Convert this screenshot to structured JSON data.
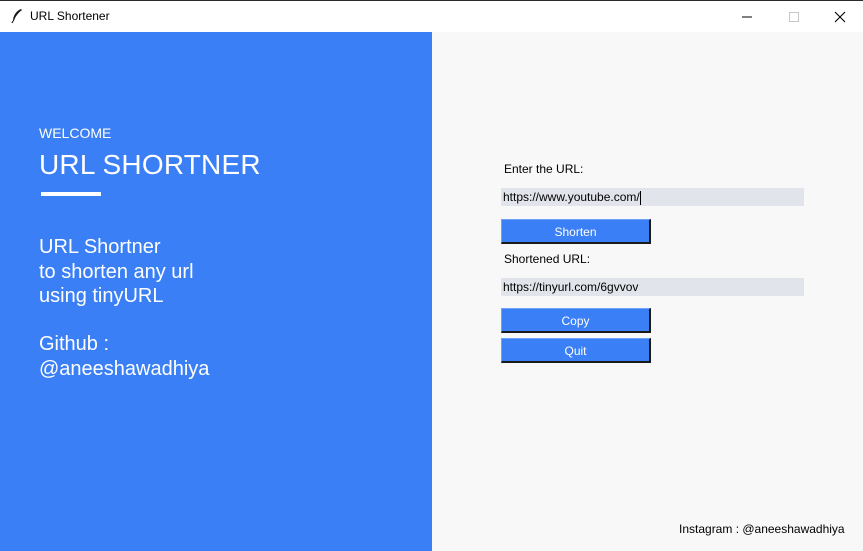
{
  "window": {
    "title": "URL Shortener",
    "icon": "feather-icon"
  },
  "left_panel": {
    "welcome": "WELCOME",
    "headline": "URL SHORTNER",
    "description_lines": [
      "URL Shortner",
      "to shorten any url",
      "using tinyURL"
    ],
    "github_label": "Github :",
    "github_handle": "@aneeshawadhiya",
    "background_color": "#3a7ff5"
  },
  "form": {
    "url_label": "Enter the URL:",
    "url_value": "https://www.youtube.com/",
    "shorten_label": "Shorten",
    "shortened_label": "Shortened URL:",
    "shortened_value": "https://tinyurl.com/6gvvov",
    "copy_label": "Copy",
    "quit_label": "Quit",
    "button_color": "#3a7ff5"
  },
  "footer": {
    "instagram": "Instagram : @aneeshawadhiya"
  }
}
